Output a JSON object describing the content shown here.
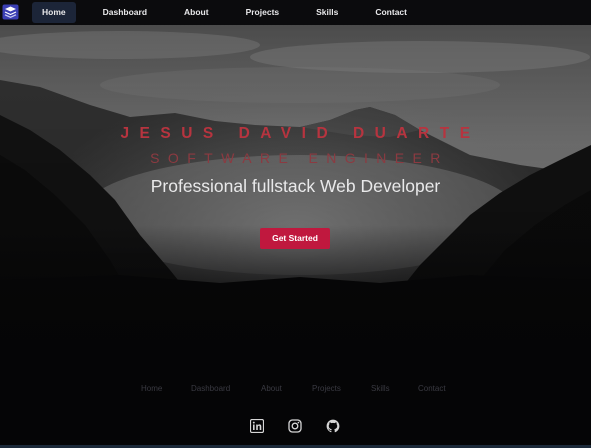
{
  "nav": {
    "logo": "logo-icon",
    "items": [
      {
        "label": "Home",
        "active": true
      },
      {
        "label": "Dashboard",
        "active": false
      },
      {
        "label": "About",
        "active": false
      },
      {
        "label": "Projects",
        "active": false
      },
      {
        "label": "Skills",
        "active": false
      },
      {
        "label": "Contact",
        "active": false
      }
    ]
  },
  "hero": {
    "name": "JESUS DAVID DUARTE",
    "role": "SOFTWARE ENGINEER",
    "tagline": "Professional fullstack Web Developer",
    "cta_label": "Get Started",
    "background": "misty-mountain-forest-photo"
  },
  "footer": {
    "links": [
      "Home",
      "Dashboard",
      "About",
      "Projects",
      "Skills",
      "Contact"
    ],
    "socials": [
      "linkedin-icon",
      "instagram-icon",
      "github-icon"
    ]
  },
  "colors": {
    "accent": "#c0183e",
    "name_text": "#b7343f",
    "role_text": "#8c3a41",
    "nav_active_bg": "#1c2538",
    "background": "#050506"
  }
}
